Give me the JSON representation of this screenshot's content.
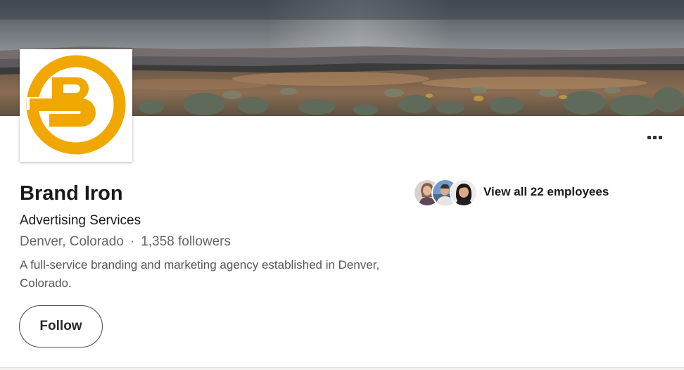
{
  "company": {
    "name": "Brand Iron",
    "industry": "Advertising Services",
    "location": "Denver, Colorado",
    "separator": "·",
    "followers": "1,358 followers",
    "tagline": "A full-service branding and marketing agency established in Denver, Colorado."
  },
  "actions": {
    "follow_label": "Follow",
    "more_icon": "ellipsis-icon"
  },
  "employees": {
    "link_label": "View all 22 employees",
    "avatar_count": 3
  },
  "cover": {
    "description_icon": "cover-landscape-image"
  },
  "logo": {
    "letter": "B",
    "color": "#f0a800"
  },
  "colors": {
    "logo_gold": "#f0a800",
    "text_primary": "#1a1a1a",
    "text_secondary": "#666666"
  }
}
